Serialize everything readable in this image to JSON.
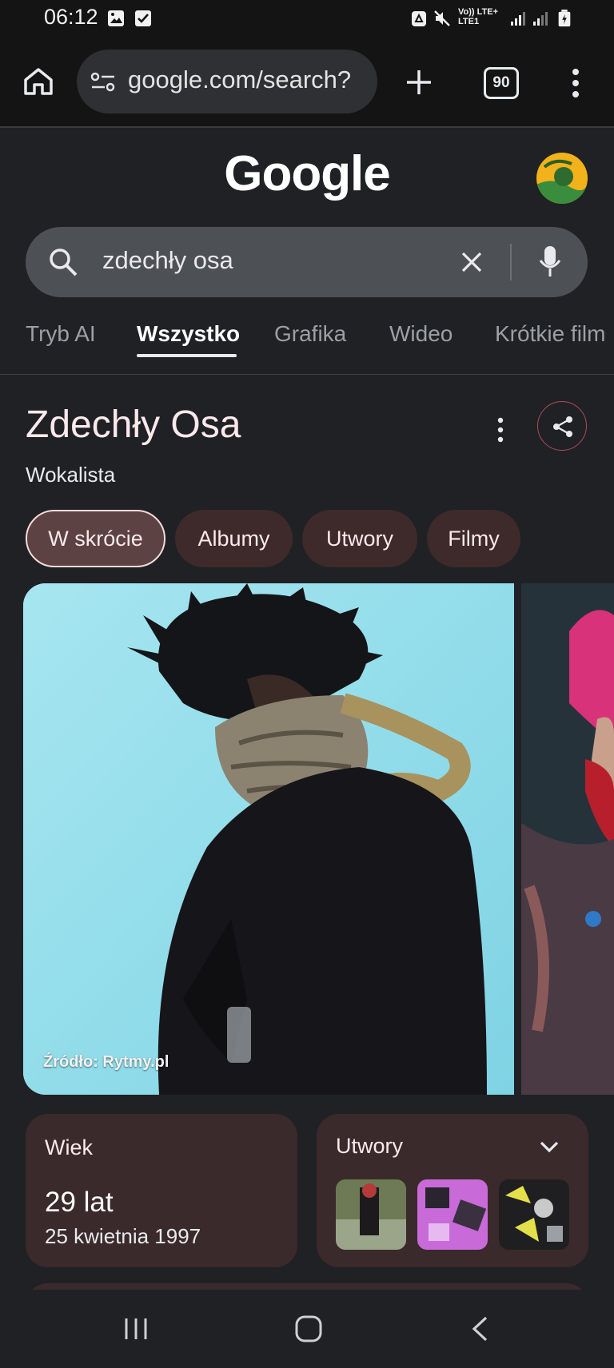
{
  "status_bar": {
    "time": "06:12",
    "network_label_1": "Vo)) LTE+",
    "network_label_2": "LTE1",
    "icons": [
      "gallery-icon",
      "check-icon",
      "recycle-icon",
      "mute-icon",
      "signal-icon",
      "signal-icon",
      "battery-icon"
    ]
  },
  "browser": {
    "url": "google.com/search?",
    "tab_count": "90"
  },
  "google": {
    "logo_text": "Google",
    "search_query": "zdechły osa"
  },
  "search_tabs": [
    {
      "label": "Tryb AI",
      "active": false
    },
    {
      "label": "Wszystko",
      "active": true
    },
    {
      "label": "Grafika",
      "active": false
    },
    {
      "label": "Wideo",
      "active": false
    },
    {
      "label": "Krótkie film",
      "active": false
    }
  ],
  "entity": {
    "title": "Zdechły Osa",
    "subtitle": "Wokalista",
    "chips": [
      {
        "label": "W skrócie",
        "active": true
      },
      {
        "label": "Albumy",
        "active": false
      },
      {
        "label": "Utwory",
        "active": false
      },
      {
        "label": "Filmy",
        "active": false
      }
    ],
    "image_source": "Źródło: Rytmy.pl"
  },
  "cards": {
    "age": {
      "label": "Wiek",
      "value": "29 lat",
      "date": "25 kwietnia 1997"
    },
    "tracks": {
      "label": "Utwory"
    }
  },
  "colors": {
    "background": "#202124",
    "chip_bg": "#3e2a2b",
    "card_bg": "#3b2a2b",
    "title_color": "#fbe9eb"
  }
}
